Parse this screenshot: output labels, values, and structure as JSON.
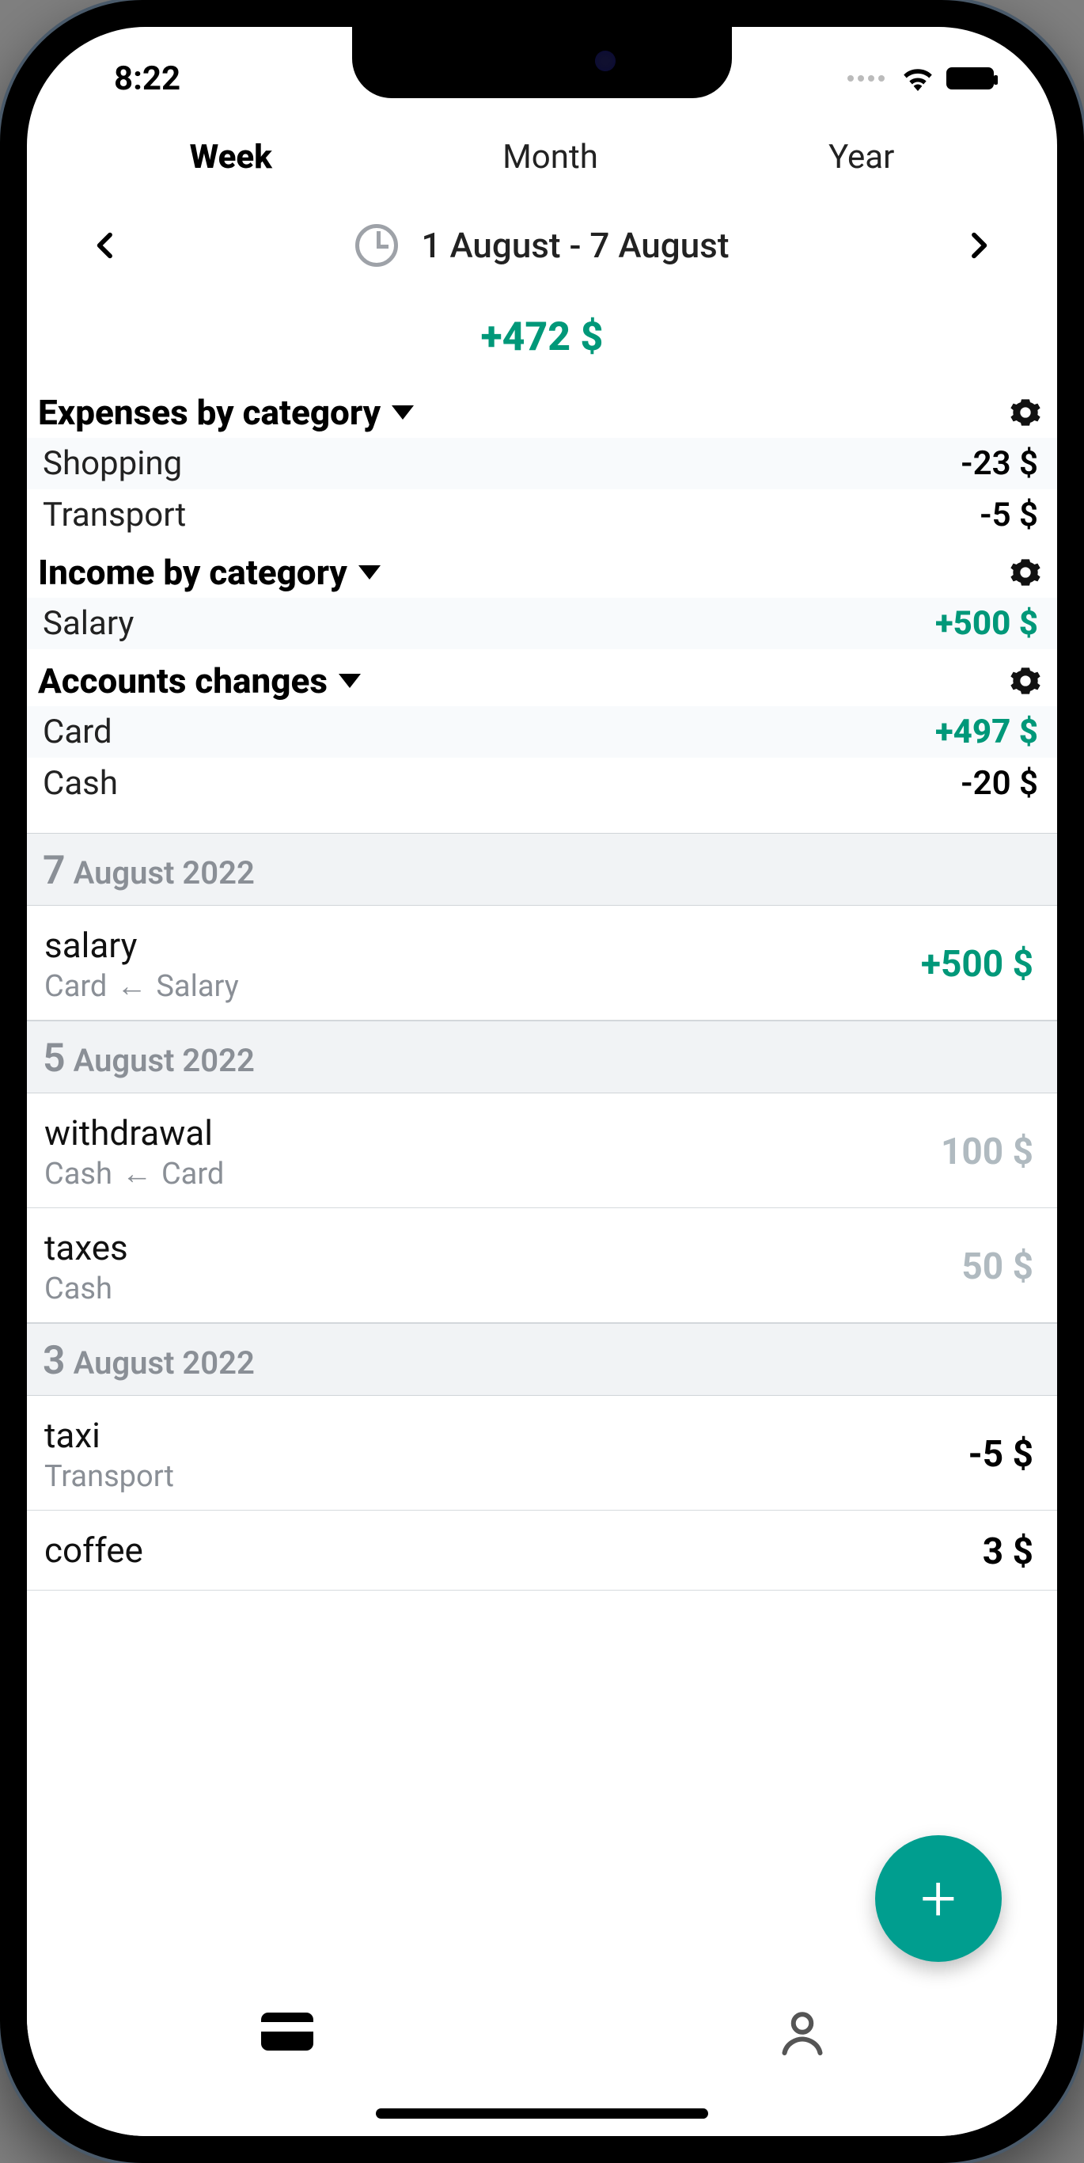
{
  "status": {
    "time": "8:22"
  },
  "tabs": {
    "week": "Week",
    "month": "Month",
    "year": "Year",
    "active": "week"
  },
  "dateRange": "1 August - 7 August",
  "balance": "+472 $",
  "colors": {
    "positive": "#009879",
    "accent": "#009e8f",
    "muted": "#8a8f96"
  },
  "sections": {
    "expenses": {
      "title": "Expenses by category",
      "rows": [
        {
          "label": "Shopping",
          "amount": "-23 $",
          "type": "neg"
        },
        {
          "label": "Transport",
          "amount": "-5 $",
          "type": "neg"
        }
      ]
    },
    "income": {
      "title": "Income by category",
      "rows": [
        {
          "label": "Salary",
          "amount": "+500 $",
          "type": "pos"
        }
      ]
    },
    "accounts": {
      "title": "Accounts changes",
      "rows": [
        {
          "label": "Card",
          "amount": "+497 $",
          "type": "pos"
        },
        {
          "label": "Cash",
          "amount": "-20 $",
          "type": "neg"
        }
      ]
    }
  },
  "transactions": [
    {
      "date": {
        "day": "7",
        "rest": "August 2022"
      },
      "items": [
        {
          "title": "salary",
          "subFrom": "Card",
          "subArrow": "←",
          "subTo": "Salary",
          "amount": "+500 $",
          "type": "pos"
        }
      ]
    },
    {
      "date": {
        "day": "5",
        "rest": "August 2022"
      },
      "items": [
        {
          "title": "withdrawal",
          "subFrom": "Cash",
          "subArrow": "←",
          "subTo": "Card",
          "amount": "100 $",
          "type": "muted"
        },
        {
          "title": "taxes",
          "subFrom": "Cash",
          "subArrow": "",
          "subTo": "",
          "amount": "50 $",
          "type": "muted"
        }
      ]
    },
    {
      "date": {
        "day": "3",
        "rest": "August 2022"
      },
      "items": [
        {
          "title": "taxi",
          "subFrom": "Transport",
          "subArrow": "",
          "subTo": "",
          "amount": "-5 $",
          "type": "neg"
        },
        {
          "title": "coffee",
          "subFrom": "",
          "subArrow": "",
          "subTo": "",
          "amount": "3 $",
          "type": "neg"
        }
      ]
    }
  ],
  "fab": "+"
}
